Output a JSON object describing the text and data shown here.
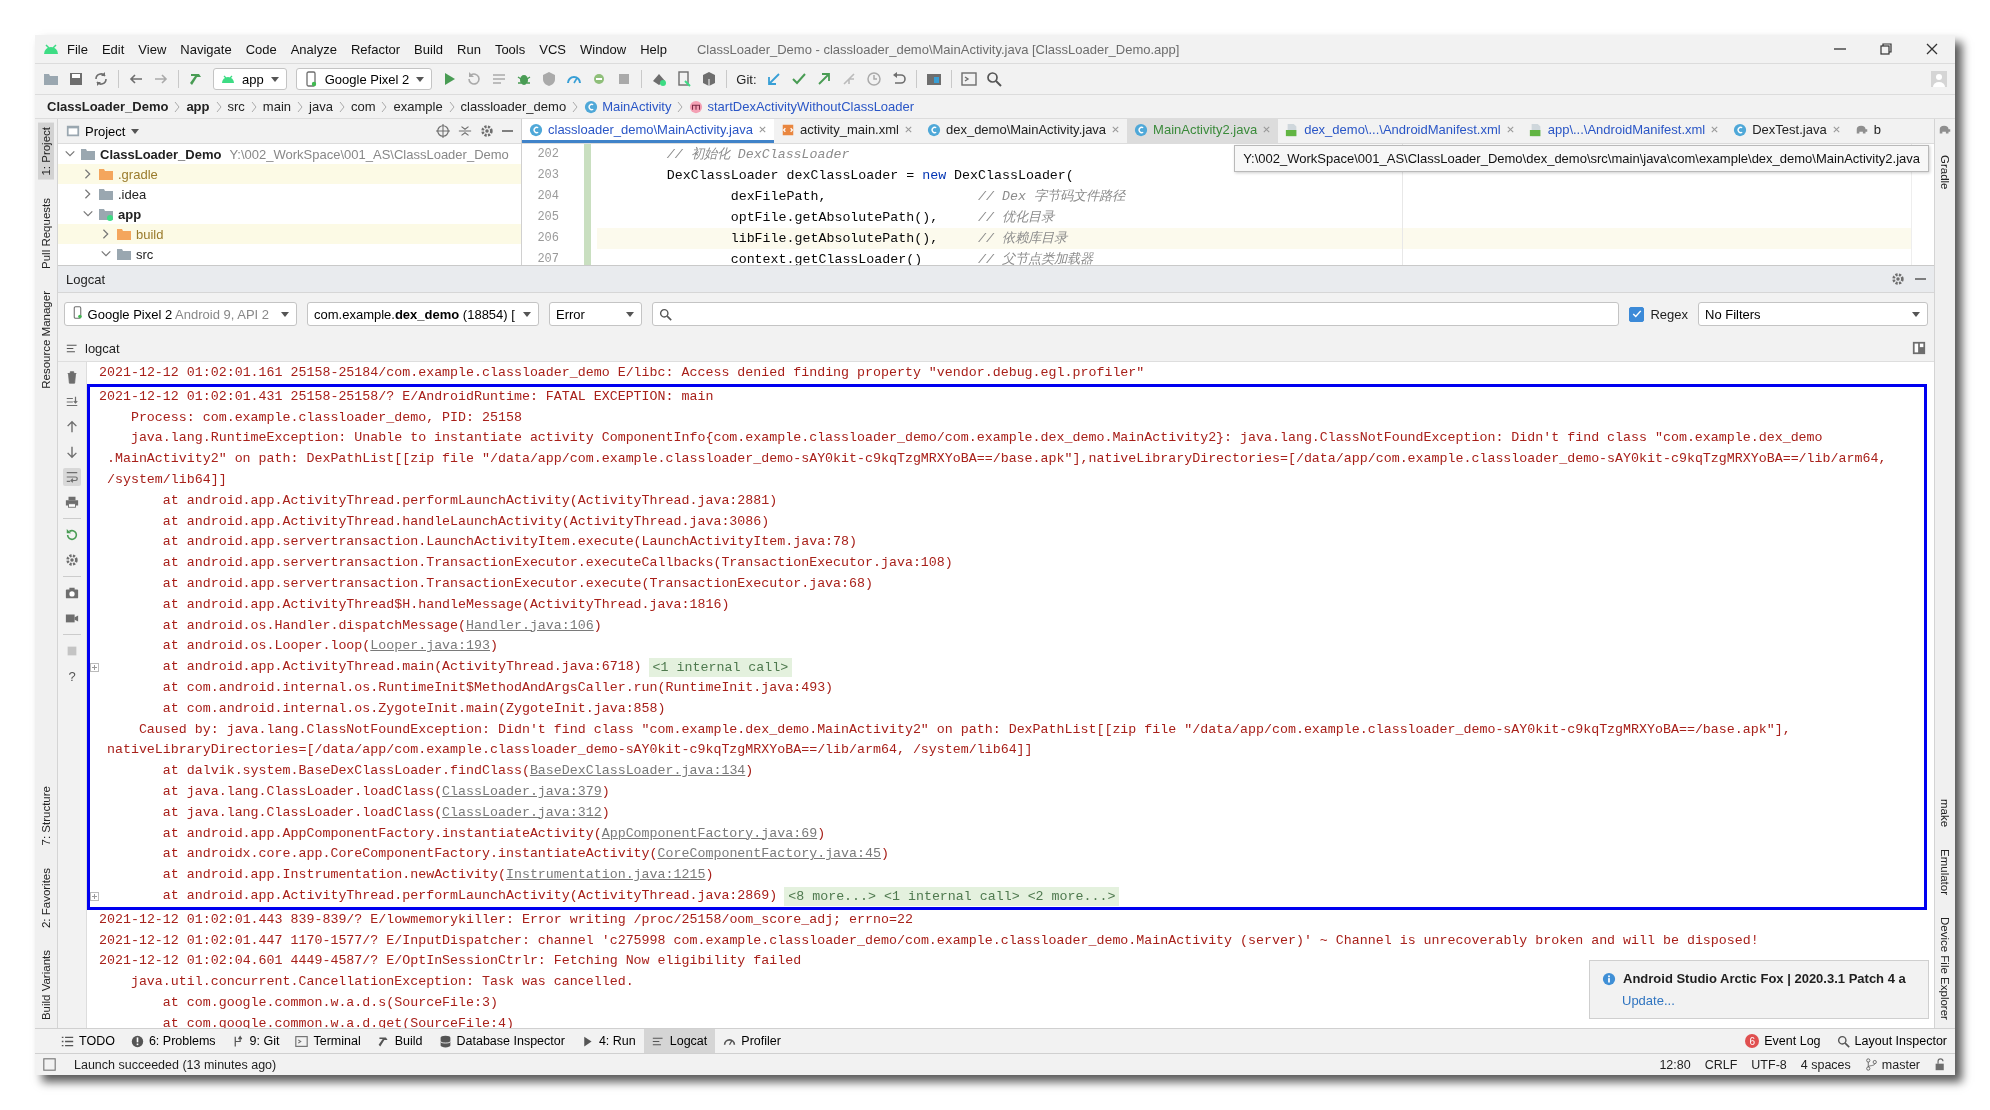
{
  "window": {
    "title": "ClassLoader_Demo - classloader_demo\\MainActivity.java [ClassLoader_Demo.app]"
  },
  "menu": [
    "File",
    "Edit",
    "View",
    "Navigate",
    "Code",
    "Analyze",
    "Refactor",
    "Build",
    "Run",
    "Tools",
    "VCS",
    "Window",
    "Help"
  ],
  "toolbar": {
    "run_config": "app",
    "device": "Google Pixel 2",
    "git_label": "Git:"
  },
  "breadcrumb": [
    {
      "label": "ClassLoader_Demo",
      "kind": "module"
    },
    {
      "label": "app",
      "kind": "module"
    },
    {
      "label": "src",
      "kind": "dir"
    },
    {
      "label": "main",
      "kind": "dir"
    },
    {
      "label": "java",
      "kind": "dir"
    },
    {
      "label": "com",
      "kind": "dir"
    },
    {
      "label": "example",
      "kind": "dir"
    },
    {
      "label": "classloader_demo",
      "kind": "dir"
    },
    {
      "label": "MainActivity",
      "kind": "class"
    },
    {
      "label": "startDexActivityWithoutClassLoader",
      "kind": "method"
    }
  ],
  "left_strip": {
    "top": [
      {
        "label": "1: Project",
        "selected": true
      },
      {
        "label": "Pull Requests",
        "selected": false
      },
      {
        "label": "Resource Manager",
        "selected": false
      }
    ],
    "bottom": [
      {
        "label": "7: Structure",
        "selected": false
      },
      {
        "label": "2: Favorites",
        "selected": false
      },
      {
        "label": "Build Variants",
        "selected": false
      }
    ]
  },
  "right_strip": {
    "top": [
      {
        "label": "Gradle"
      }
    ],
    "bottom": [
      {
        "label": "make"
      },
      {
        "label": "Emulator"
      },
      {
        "label": "Device File Explorer"
      }
    ]
  },
  "project_panel": {
    "title": "Project",
    "tree": [
      {
        "label": "ClassLoader_Demo",
        "path": "Y:\\002_WorkSpace\\001_AS\\ClassLoader_Demo",
        "kind": "project",
        "expanded": true,
        "children": [
          {
            "label": ".gradle",
            "kind": "folder",
            "excluded": true,
            "expanded": false
          },
          {
            "label": ".idea",
            "kind": "folder",
            "excluded": false,
            "expanded": false
          },
          {
            "label": "app",
            "kind": "module",
            "excluded": false,
            "expanded": true,
            "children": [
              {
                "label": "build",
                "kind": "folder",
                "excluded": true,
                "expanded": false
              },
              {
                "label": "src",
                "kind": "folder",
                "excluded": false,
                "expanded": true
              }
            ]
          }
        ]
      }
    ]
  },
  "editor": {
    "tabs": [
      {
        "label": "classloader_demo\\MainActivity.java",
        "kind": "class",
        "color": "#2a56c6",
        "selected": true,
        "hovered": false
      },
      {
        "label": "activity_main.xml",
        "kind": "xml",
        "color": "#222222",
        "selected": false,
        "hovered": false
      },
      {
        "label": "dex_demo\\MainActivity.java",
        "kind": "class",
        "color": "#222222",
        "selected": false,
        "hovered": false
      },
      {
        "label": "MainActivity2.java",
        "kind": "class",
        "color": "#3a8a3a",
        "selected": false,
        "hovered": true
      },
      {
        "label": "dex_demo\\...\\AndroidManifest.xml",
        "kind": "manifest",
        "color": "#2a56c6",
        "selected": false,
        "hovered": false
      },
      {
        "label": "app\\...\\AndroidManifest.xml",
        "kind": "manifest",
        "color": "#2a56c6",
        "selected": false,
        "hovered": false
      },
      {
        "label": "DexTest.java",
        "kind": "class",
        "color": "#222222",
        "selected": false,
        "hovered": false
      },
      {
        "label": "b",
        "kind": "gradle",
        "color": "#222222",
        "selected": false,
        "hovered": false
      }
    ],
    "tooltip": "Y:\\002_WorkSpace\\001_AS\\ClassLoader_Demo\\dex_demo\\src\\main\\java\\com\\example\\dex_demo\\MainActivity2.java",
    "lines": [
      {
        "number": "202",
        "current": false,
        "segments": [
          {
            "kind": "comment",
            "text": "        // 初始化 DexClassLoader"
          }
        ]
      },
      {
        "number": "203",
        "current": false,
        "segments": [
          {
            "kind": "plain",
            "text": "        DexClassLoader dexClassLoader = "
          },
          {
            "kind": "keyword",
            "text": "new"
          },
          {
            "kind": "plain",
            "text": " DexClassLoader("
          }
        ]
      },
      {
        "number": "204",
        "current": false,
        "segments": [
          {
            "kind": "plain",
            "text": "                dexFilePath,                   "
          },
          {
            "kind": "comment",
            "text": "// Dex 字节码文件路径"
          }
        ]
      },
      {
        "number": "205",
        "current": false,
        "segments": [
          {
            "kind": "plain",
            "text": "                optFile.getAbsolutePath(),     "
          },
          {
            "kind": "comment",
            "text": "// 优化目录"
          }
        ]
      },
      {
        "number": "206",
        "current": true,
        "segments": [
          {
            "kind": "plain",
            "text": "                libFile.getAbsolutePath(),     "
          },
          {
            "kind": "comment",
            "text": "// 依赖库目录"
          }
        ]
      },
      {
        "number": "207",
        "current": false,
        "segments": [
          {
            "kind": "plain",
            "text": "                context.getClassLoader()       "
          },
          {
            "kind": "comment",
            "text": "// 父节点类加载器"
          }
        ]
      }
    ]
  },
  "logcat": {
    "title": "Logcat",
    "device": {
      "name": "Google Pixel 2",
      "detail": "Android 9, API 2"
    },
    "process": "com.example.**dex_demo** (18854) [",
    "level": "Error",
    "regex": {
      "label": "Regex",
      "checked": true
    },
    "filter": "No Filters",
    "view_label": "logcat",
    "help": "?",
    "groups": [
      {
        "framed": false,
        "lines": [
          {
            "kind": "entry",
            "text": "2021-12-12 01:02:01.161 25158-25184/com.example.classloader_demo E/libc: Access denied finding property \"vendor.debug.egl.profiler\""
          }
        ]
      },
      {
        "framed": true,
        "lines": [
          {
            "kind": "entry",
            "text": "2021-12-12 01:02:01.431 25158-25158/? E/AndroidRuntime: FATAL EXCEPTION: main"
          },
          {
            "kind": "detail",
            "text": "Process: com.example.classloader_demo, PID: 25158"
          },
          {
            "kind": "detail",
            "text": "java.lang.RuntimeException: Unable to instantiate activity ComponentInfo{com.example.classloader_demo/com.example.dex_demo.MainActivity2}: java.lang.ClassNotFoundException: Didn't find class \"com.example.dex_demo"
          },
          {
            "kind": "continuation",
            "text": ".MainActivity2\" on path: DexPathList[[zip file \"/data/app/com.example.classloader_demo-sAY0kit-c9kqTzgMRXYoBA==/base.apk\"],nativeLibraryDirectories=[/data/app/com.example.classloader_demo-sAY0kit-c9kqTzgMRXYoBA==/lib/arm64,"
          },
          {
            "kind": "continuation",
            "text": "/system/lib64]]"
          },
          {
            "kind": "frame",
            "text": "at android.app.ActivityThread.performLaunchActivity(ActivityThread.java:2881)"
          },
          {
            "kind": "frame",
            "text": "at android.app.ActivityThread.handleLaunchActivity(ActivityThread.java:3086)"
          },
          {
            "kind": "frame",
            "text": "at android.app.servertransaction.LaunchActivityItem.execute(LaunchActivityItem.java:78)"
          },
          {
            "kind": "frame",
            "text": "at android.app.servertransaction.TransactionExecutor.executeCallbacks(TransactionExecutor.java:108)"
          },
          {
            "kind": "frame",
            "text": "at android.app.servertransaction.TransactionExecutor.execute(TransactionExecutor.java:68)"
          },
          {
            "kind": "frame",
            "text": "at android.app.ActivityThread$H.handleMessage(ActivityThread.java:1816)"
          },
          {
            "kind": "frame",
            "text": "at android.os.Handler.dispatchMessage(",
            "link": "Handler.java:106",
            "tail": ")"
          },
          {
            "kind": "frame",
            "text": "at android.os.Looper.loop(",
            "link": "Looper.java:193",
            "tail": ")"
          },
          {
            "kind": "frame",
            "text": "at android.app.ActivityThread.main(ActivityThread.java:6718)",
            "fold": "<1 internal call>"
          },
          {
            "kind": "frame",
            "text": "at com.android.internal.os.RuntimeInit$MethodAndArgsCaller.run(RuntimeInit.java:493)"
          },
          {
            "kind": "frame",
            "text": "at com.android.internal.os.ZygoteInit.main(ZygoteInit.java:858)"
          },
          {
            "kind": "cause",
            "text": "Caused by: java.lang.ClassNotFoundException: Didn't find class \"com.example.dex_demo.MainActivity2\" on path: DexPathList[[zip file \"/data/app/com.example.classloader_demo-sAY0kit-c9kqTzgMRXYoBA==/base.apk\"],"
          },
          {
            "kind": "continuation",
            "text": "nativeLibraryDirectories=[/data/app/com.example.classloader_demo-sAY0kit-c9kqTzgMRXYoBA==/lib/arm64, /system/lib64]]"
          },
          {
            "kind": "frame",
            "text": "at dalvik.system.BaseDexClassLoader.findClass(",
            "link": "BaseDexClassLoader.java:134",
            "tail": ")"
          },
          {
            "kind": "frame",
            "text": "at java.lang.ClassLoader.loadClass(",
            "link": "ClassLoader.java:379",
            "tail": ")"
          },
          {
            "kind": "frame",
            "text": "at java.lang.ClassLoader.loadClass(",
            "link": "ClassLoader.java:312",
            "tail": ")"
          },
          {
            "kind": "frame",
            "text": "at android.app.AppComponentFactory.instantiateActivity(",
            "link": "AppComponentFactory.java:69",
            "tail": ")"
          },
          {
            "kind": "frame",
            "text": "at androidx.core.app.CoreComponentFactory.instantiateActivity(",
            "link": "CoreComponentFactory.java:45",
            "tail": ")"
          },
          {
            "kind": "frame",
            "text": "at android.app.Instrumentation.newActivity(",
            "link": "Instrumentation.java:1215",
            "tail": ")"
          },
          {
            "kind": "frame",
            "text": "at android.app.ActivityThread.performLaunchActivity(ActivityThread.java:2869)",
            "fold": "<8 more...> <1 internal call> <2 more...>"
          }
        ]
      },
      {
        "framed": false,
        "lines": [
          {
            "kind": "entry",
            "text": "2021-12-12 01:02:01.443 839-839/? E/lowmemorykiller: Error writing /proc/25158/oom_score_adj; errno=22"
          },
          {
            "kind": "entry",
            "text": "2021-12-12 01:02:01.447 1170-1577/? E/InputDispatcher: channel 'c275998 com.example.classloader_demo/com.example.classloader_demo.MainActivity (server)' ~ Channel is unrecoverably broken and will be disposed!"
          },
          {
            "kind": "entry",
            "text": "2021-12-12 01:02:04.601 4449-4587/? E/OptInSessionCtrlr: Fetching Now eligibility failed"
          },
          {
            "kind": "detail",
            "text": "java.util.concurrent.CancellationException: Task was cancelled."
          },
          {
            "kind": "frame",
            "text": "at com.google.common.w.a.d.s(SourceFile:3)"
          },
          {
            "kind": "frame",
            "text": "at com.google.common.w.a.d.get(SourceFile:4)"
          }
        ]
      }
    ]
  },
  "notification": {
    "title": "Android Studio Arctic Fox | 2020.3.1 Patch 4 a",
    "link": "Update..."
  },
  "bottom_tabs": [
    {
      "label": "TODO",
      "kind": "todo",
      "selected": false
    },
    {
      "label": "6: Problems",
      "kind": "problems",
      "selected": false
    },
    {
      "label": "9: Git",
      "kind": "git",
      "selected": false
    },
    {
      "label": "Terminal",
      "kind": "terminal",
      "selected": false
    },
    {
      "label": "Build",
      "kind": "build",
      "selected": false
    },
    {
      "label": "Database Inspector",
      "kind": "database",
      "selected": false
    },
    {
      "label": "4: Run",
      "kind": "run",
      "selected": false
    },
    {
      "label": "Logcat",
      "kind": "logcat",
      "selected": true
    },
    {
      "label": "Profiler",
      "kind": "profiler",
      "selected": false
    }
  ],
  "bottom_right_tabs": [
    {
      "label": "Event Log",
      "badge": "6"
    },
    {
      "label": "Layout Inspector"
    }
  ],
  "status_bar": {
    "message": "Launch succeeded (13 minutes ago)",
    "items": [
      "12:80",
      "CRLF",
      "UTF-8",
      "4 spaces"
    ],
    "branch": "master"
  }
}
